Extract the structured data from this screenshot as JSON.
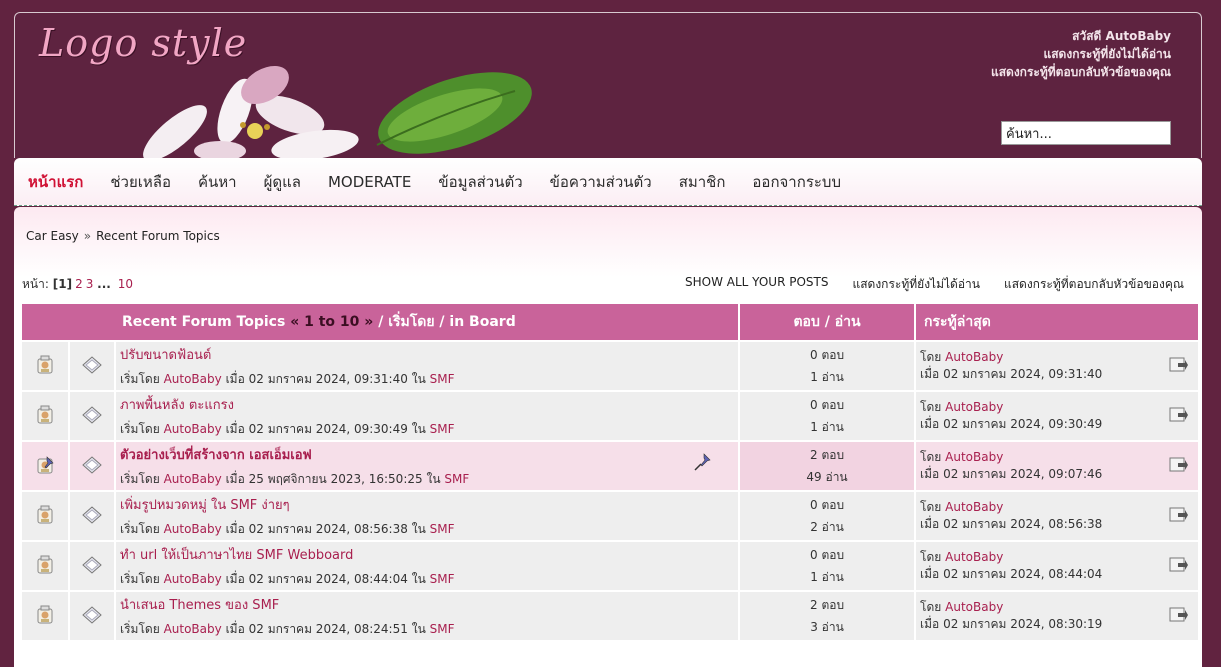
{
  "header": {
    "logo_text": "Logo style",
    "user_links": [
      "สวัสดี AutoBaby",
      "แสดงกระทู้ที่ยังไม่ได้อ่าน",
      "แสดงกระทู้ที่ตอบกลับหัวข้อของคุณ"
    ],
    "search_value": "ค้นหา..."
  },
  "menu": {
    "items": [
      "หน้าแรก",
      "ช่วยเหลือ",
      "ค้นหา",
      "ผู้ดูแล",
      "MODERATE",
      "ข้อมูลส่วนตัว",
      "ข้อความส่วนตัว",
      "สมาชิก",
      "ออกจากระบบ"
    ]
  },
  "breadcrumb": {
    "items": [
      "Car Easy",
      "Recent Forum Topics"
    ],
    "separator": "»"
  },
  "pagination": {
    "label": "หน้า:",
    "current": "[1]",
    "pages": [
      "2",
      "3"
    ],
    "ellipsis": "...",
    "last": "10"
  },
  "actions": [
    "SHOW ALL YOUR POSTS",
    "แสดงกระทู้ที่ยังไม่ได้อ่าน",
    "แสดงกระทู้ที่ตอบกลับหัวข้อของคุณ"
  ],
  "table": {
    "header_title": "Recent Forum Topics",
    "header_range_open": "«",
    "header_range": "1 to 10",
    "header_range_close": "»",
    "header_started_by": "/ เริ่มโดย",
    "header_board": "/ in Board",
    "header_replies": "ตอบ",
    "header_views": "อ่าน",
    "header_sep": "/",
    "header_lastpost": "กระทู้ล่าสุด",
    "started_by_prefix": "เริ่มโดย",
    "when_prefix": "เมื่อ",
    "in_prefix": "ใน",
    "by_prefix": "โดย",
    "replies_suffix": "ตอบ",
    "views_suffix": "อ่าน",
    "rows": [
      {
        "title": "ปรับขนาดฟ้อนต์",
        "author": "AutoBaby",
        "date": "02 มกราคม 2024, 09:31:40",
        "board": "SMF",
        "replies": "0",
        "views": "1",
        "last_by": "AutoBaby",
        "last_date": "02 มกราคม 2024, 09:31:40",
        "sticky": false
      },
      {
        "title": "ภาพพื้นหลัง ตะแกรง",
        "author": "AutoBaby",
        "date": "02 มกราคม 2024, 09:30:49",
        "board": "SMF",
        "replies": "0",
        "views": "1",
        "last_by": "AutoBaby",
        "last_date": "02 มกราคม 2024, 09:30:49",
        "sticky": false
      },
      {
        "title": "ตัวอย่างเว็บที่สร้างจาก เอสเอ็มเอฟ",
        "author": "AutoBaby",
        "date": "25 พฤศจิกายน 2023, 16:50:25",
        "board": "SMF",
        "replies": "2",
        "views": "49",
        "last_by": "AutoBaby",
        "last_date": "02 มกราคม 2024, 09:07:46",
        "sticky": true
      },
      {
        "title": "เพิ่มรูปหมวดหมู่ ใน SMF ง่ายๆ",
        "author": "AutoBaby",
        "date": "02 มกราคม 2024, 08:56:38",
        "board": "SMF",
        "replies": "0",
        "views": "2",
        "last_by": "AutoBaby",
        "last_date": "02 มกราคม 2024, 08:56:38",
        "sticky": false
      },
      {
        "title": "ทำ url ให้เป็นภาษาไทย SMF Webboard",
        "author": "AutoBaby",
        "date": "02 มกราคม 2024, 08:44:04",
        "board": "SMF",
        "replies": "0",
        "views": "1",
        "last_by": "AutoBaby",
        "last_date": "02 มกราคม 2024, 08:44:04",
        "sticky": false
      },
      {
        "title": "นำเสนอ Themes ของ SMF",
        "author": "AutoBaby",
        "date": "02 มกราคม 2024, 08:24:51",
        "board": "SMF",
        "replies": "2",
        "views": "3",
        "last_by": "AutoBaby",
        "last_date": "02 มกราคม 2024, 08:30:19",
        "sticky": false
      }
    ]
  },
  "colors": {
    "background": "#612340",
    "table_header": "#c9639a",
    "link": "#a81f4e",
    "active_menu": "#d01235"
  }
}
